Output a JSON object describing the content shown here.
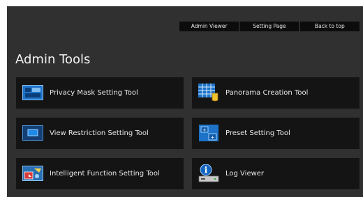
{
  "nav": {
    "admin_viewer": "Admin Viewer",
    "setting_page": "Setting Page",
    "back_to_top": "Back to top"
  },
  "page_title": "Admin Tools",
  "tools": [
    {
      "label": "Privacy Mask Setting Tool",
      "icon": "privacy-mask-icon"
    },
    {
      "label": "Panorama Creation Tool",
      "icon": "panorama-grid-icon"
    },
    {
      "label": "View Restriction Setting Tool",
      "icon": "view-restriction-icon"
    },
    {
      "label": "Preset Setting Tool",
      "icon": "preset-icon"
    },
    {
      "label": "Intelligent Function Setting Tool",
      "icon": "intelligent-function-icon"
    },
    {
      "label": "Log Viewer",
      "icon": "log-viewer-info-icon"
    }
  ],
  "colors": {
    "panel_background": "#303030",
    "tile_background": "#141414",
    "nav_background": "#0c0c0c",
    "icon_blue": "#1c7fd6"
  }
}
